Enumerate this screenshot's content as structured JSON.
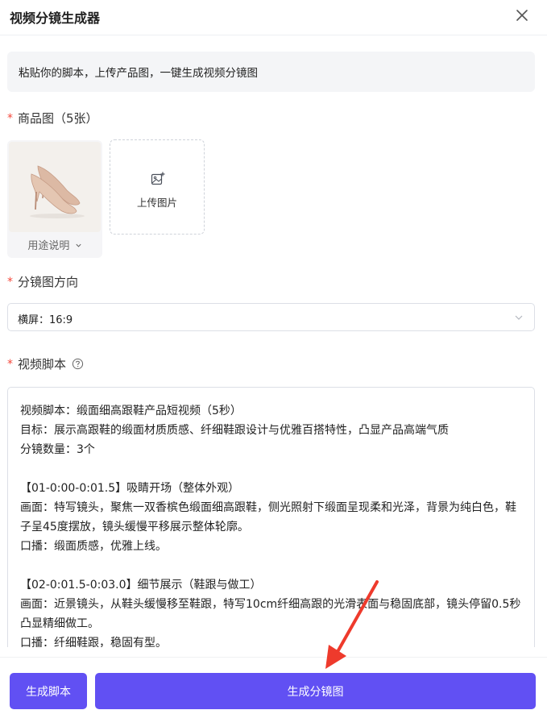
{
  "header": {
    "title": "视频分镜生成器",
    "close_icon": "close-icon"
  },
  "notice": {
    "text": "粘贴你的脚本，上传产品图，一键生成视频分镜图"
  },
  "product_images": {
    "label": "商品图（5张）",
    "required_mark": "*",
    "thumbnail": {
      "caption": "用途说明",
      "caption_icon": "chevron-down-icon"
    },
    "upload": {
      "label": "上传图片",
      "icon": "image-add-icon"
    }
  },
  "orientation": {
    "label": "分镜图方向",
    "required_mark": "*",
    "selected": "横屏：16:9"
  },
  "script": {
    "label": "视频脚本",
    "required_mark": "*",
    "help_icon": "help-circle-icon",
    "lines": {
      "l1": "视频脚本：缎面细高跟鞋产品短视频（5秒）",
      "l2": "目标：展示高跟鞋的缎面材质质感、纤细鞋跟设计与优雅百搭特性，凸显产品高端气质",
      "l3": "分镜数量：3个",
      "l4": "【01-0:00-0:01.5】吸睛开场（整体外观）",
      "l5": "画面：特写镜头，聚焦一双香槟色缎面细高跟鞋，侧光照射下缎面呈现柔和光泽，背景为纯白色，鞋子呈45度摆放，镜头缓慢平移展示整体轮廓。",
      "l6": "口播：缎面质感，优雅上线。",
      "l7": "【02-0:01.5-0:03.0】细节展示（鞋跟与做工）",
      "l8": "画面：近景镜头，从鞋头缓慢移至鞋跟，特写10cm纤细高跟的光滑表面与稳固底部，镜头停留0.5秒凸显精细做工。",
      "l9": "口播：纤细鞋跟，稳固有型。"
    }
  },
  "footer": {
    "generate_script": "生成脚本",
    "generate_storyboard": "生成分镜图"
  },
  "colors": {
    "primary": "#6150f3",
    "required": "#f5483b",
    "annotation": "#ee3a2c"
  }
}
